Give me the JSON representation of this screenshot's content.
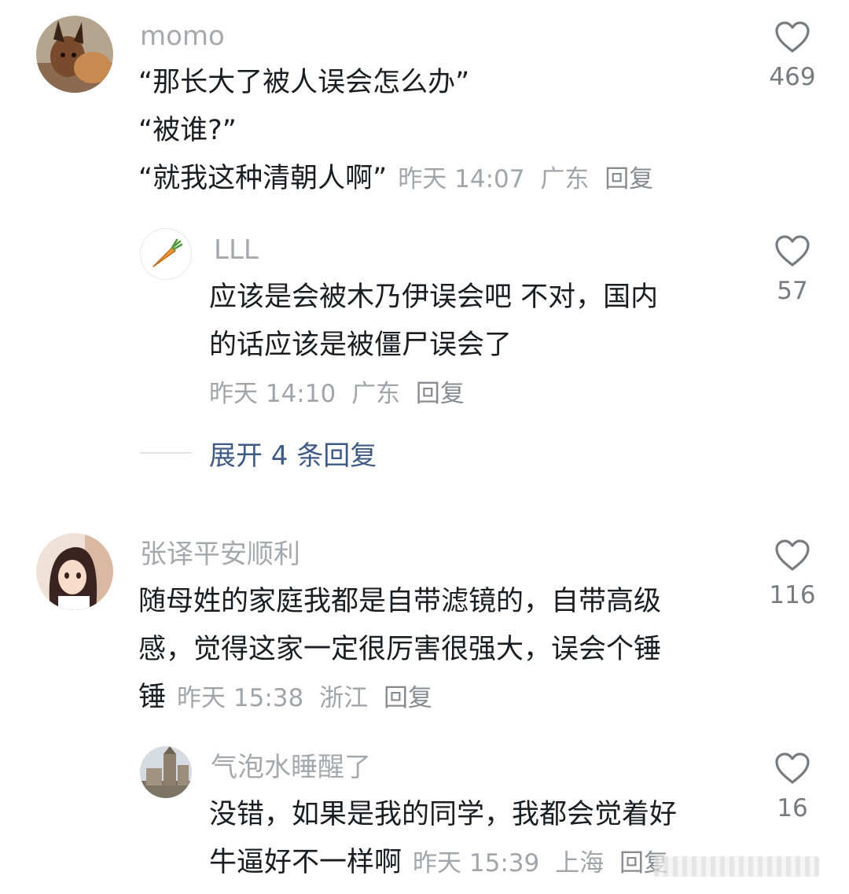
{
  "comments": [
    {
      "username": "momo",
      "lines": [
        "“那长大了被人误会怎么办”",
        "“被谁?”",
        "“就我这种清朝人啊”"
      ],
      "time": "昨天 14:07",
      "location": "广东",
      "reply_label": "回复",
      "likes": "469",
      "avatar_icon": "cat-avatar-icon",
      "replies": [
        {
          "username": "LLL",
          "lines": [
            "应该是会被木乃伊误会吧 不对，国内",
            "的话应该是被僵尸误会了"
          ],
          "time": "昨天 14:10",
          "location": "广东",
          "reply_label": "回复",
          "likes": "57",
          "avatar_icon": "carrot-avatar-icon"
        }
      ],
      "expand_label": "展开 4 条回复"
    },
    {
      "username": "张译平安顺利",
      "lines": [
        "随母姓的家庭我都是自带滤镜的，自带高级",
        "感，觉得这家一定很厉害很强大，误会个锤",
        "锤"
      ],
      "time": "昨天 15:38",
      "location": "浙江",
      "reply_label": "回复",
      "likes": "116",
      "avatar_icon": "anime-girl-avatar-icon",
      "replies": [
        {
          "username": "气泡水睡醒了",
          "lines": [
            "没错，如果是我的同学，我都会觉着好",
            "牛逼好不一样啊"
          ],
          "time": "昨天 15:39",
          "location": "上海",
          "reply_label": "回复",
          "likes": "16",
          "avatar_icon": "building-avatar-icon"
        }
      ]
    }
  ],
  "colors": {
    "username": "#a7a8ad",
    "text": "#1c1d22",
    "meta": "#a3a4aa",
    "expand": "#3f5a84",
    "heart": "#7a7b81"
  }
}
